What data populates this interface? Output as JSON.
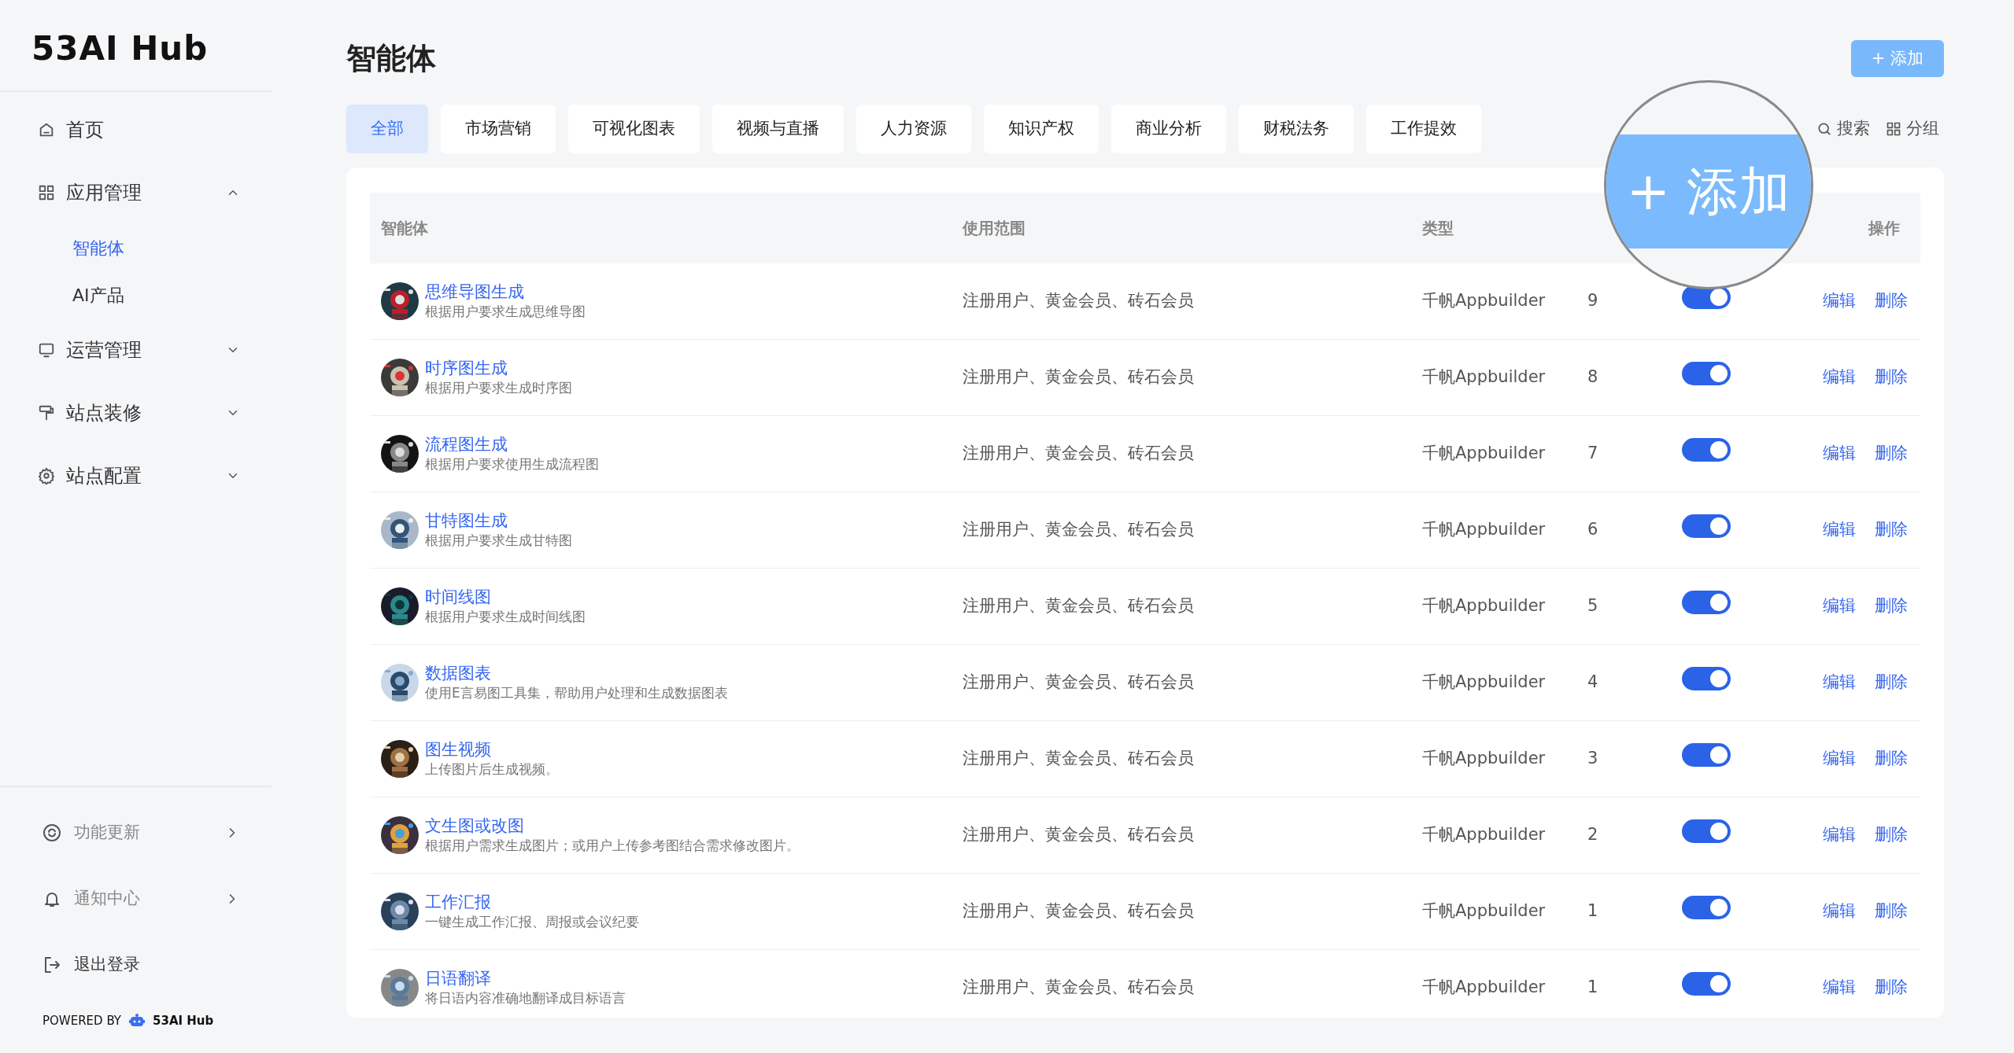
{
  "sidebar": {
    "logo": "53AI Hub",
    "items": [
      {
        "label": "首页"
      },
      {
        "label": "应用管理",
        "expanded": true,
        "children": [
          {
            "label": "智能体",
            "selected": true
          },
          {
            "label": "AI产品",
            "selected": false
          }
        ]
      },
      {
        "label": "运营管理",
        "expanded": false
      },
      {
        "label": "站点装修",
        "expanded": false
      },
      {
        "label": "站点配置",
        "expanded": false
      }
    ],
    "footer_items": [
      {
        "label": "功能更新",
        "kind": "panel"
      },
      {
        "label": "通知中心",
        "kind": "panel"
      },
      {
        "label": "退出登录",
        "kind": "action"
      }
    ],
    "powered_by": {
      "label": "POWERED BY",
      "brand": "53AI Hub"
    }
  },
  "header": {
    "title": "智能体",
    "add_button": "+ 添加"
  },
  "tabs": [
    {
      "label": "全部",
      "selected": true
    },
    {
      "label": "市场营销",
      "selected": false
    },
    {
      "label": "可视化图表",
      "selected": false
    },
    {
      "label": "视频与直播",
      "selected": false
    },
    {
      "label": "人力资源",
      "selected": false
    },
    {
      "label": "知识产权",
      "selected": false
    },
    {
      "label": "商业分析",
      "selected": false
    },
    {
      "label": "财税法务",
      "selected": false
    },
    {
      "label": "工作提效",
      "selected": false
    }
  ],
  "tools": [
    "搜索",
    "分组"
  ],
  "table": {
    "columns": [
      "智能体",
      "使用范围",
      "类型",
      "操作"
    ],
    "rows": [
      {
        "name": "思维导图生成",
        "description": "根据用户要求生成思维导图",
        "scope": "注册用户、黄金会员、砖石会员",
        "type": "千帆Appbuilder",
        "order": "9",
        "enabled": true,
        "actions": [
          "编辑",
          "删除"
        ]
      },
      {
        "name": "时序图生成",
        "description": "根据用户要求生成时序图",
        "scope": "注册用户、黄金会员、砖石会员",
        "type": "千帆Appbuilder",
        "order": "8",
        "enabled": true,
        "actions": [
          "编辑",
          "删除"
        ]
      },
      {
        "name": "流程图生成",
        "description": "根据用户要求使用生成流程图",
        "scope": "注册用户、黄金会员、砖石会员",
        "type": "千帆Appbuilder",
        "order": "7",
        "enabled": true,
        "actions": [
          "编辑",
          "删除"
        ]
      },
      {
        "name": "甘特图生成",
        "description": "根据用户要求生成甘特图",
        "scope": "注册用户、黄金会员、砖石会员",
        "type": "千帆Appbuilder",
        "order": "6",
        "enabled": true,
        "actions": [
          "编辑",
          "删除"
        ]
      },
      {
        "name": "时间线图",
        "description": "根据用户要求生成时间线图",
        "scope": "注册用户、黄金会员、砖石会员",
        "type": "千帆Appbuilder",
        "order": "5",
        "enabled": true,
        "actions": [
          "编辑",
          "删除"
        ]
      },
      {
        "name": "数据图表",
        "description": "使用E言易图工具集，帮助用户处理和生成数据图表",
        "scope": "注册用户、黄金会员、砖石会员",
        "type": "千帆Appbuilder",
        "order": "4",
        "enabled": true,
        "actions": [
          "编辑",
          "删除"
        ]
      },
      {
        "name": "图生视频",
        "description": "上传图片后生成视频。",
        "scope": "注册用户、黄金会员、砖石会员",
        "type": "千帆Appbuilder",
        "order": "3",
        "enabled": true,
        "actions": [
          "编辑",
          "删除"
        ]
      },
      {
        "name": "文生图或改图",
        "description": "根据用户需求生成图片；或用户上传参考图结合需求修改图片。",
        "scope": "注册用户、黄金会员、砖石会员",
        "type": "千帆Appbuilder",
        "order": "2",
        "enabled": true,
        "actions": [
          "编辑",
          "删除"
        ]
      },
      {
        "name": "工作汇报",
        "description": "一键生成工作汇报、周报或会议纪要",
        "scope": "注册用户、黄金会员、砖石会员",
        "type": "千帆Appbuilder",
        "order": "1",
        "enabled": true,
        "actions": [
          "编辑",
          "删除"
        ]
      },
      {
        "name": "日语翻译",
        "description": "将日语内容准确地翻译成目标语言",
        "scope": "注册用户、黄金会员、砖石会员",
        "type": "千帆Appbuilder",
        "order": "1",
        "enabled": true,
        "actions": [
          "编辑",
          "删除"
        ]
      }
    ]
  },
  "magnifier": {
    "text": "+ 添加"
  }
}
